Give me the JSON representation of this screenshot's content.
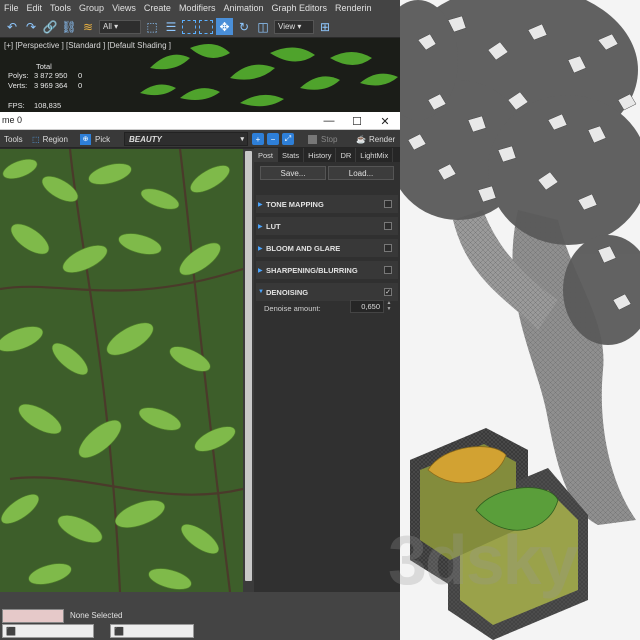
{
  "menubar": {
    "items": [
      "File",
      "Edit",
      "Tools",
      "Group",
      "Views",
      "Create",
      "Modifiers",
      "Animation",
      "Graph Editors",
      "Renderin"
    ]
  },
  "toolbar": {
    "selection_filter": "All",
    "view_dropdown": "View",
    "icons": [
      "undo-icon",
      "redo-icon",
      "link-icon",
      "unlink-icon",
      "bind-spacewarp-icon",
      "select-icon",
      "select-by-name-icon",
      "rect-region-icon",
      "window-crossing-icon",
      "move-icon",
      "rotate-icon",
      "scale-icon"
    ]
  },
  "viewport": {
    "label": "[+] [Perspective ] [Standard ] [Default Shading ]",
    "total_label": "Total",
    "polys_label": "Polys:",
    "polys_total": "3 872 950",
    "polys_sel": "0",
    "verts_label": "Verts:",
    "verts_total": "3 969 364",
    "verts_sel": "0",
    "fps_label": "FPS:",
    "fps_value": "108,835"
  },
  "frame_buffer": {
    "title": "me 0",
    "minimize": "—",
    "maximize": "☐",
    "close": "✕",
    "tools_label": "Tools",
    "region_label": "Region",
    "pick_label": "Pick",
    "channel": "BEAUTY",
    "stop_label": "Stop",
    "render_label": "Render"
  },
  "post_panel": {
    "tabs": [
      "Post",
      "Stats",
      "History",
      "DR",
      "LightMix"
    ],
    "save_label": "Save...",
    "load_label": "Load...",
    "sections": [
      {
        "label": "TONE MAPPING",
        "arrow": "▶",
        "checked": ""
      },
      {
        "label": "LUT",
        "arrow": "▶",
        "checked": ""
      },
      {
        "label": "BLOOM AND GLARE",
        "arrow": "▶",
        "checked": ""
      },
      {
        "label": "SHARPENING/BLURRING",
        "arrow": "▶",
        "checked": ""
      },
      {
        "label": "DENOISING",
        "arrow": "▼",
        "checked": "✓"
      }
    ],
    "denoise_label": "Denoise amount:",
    "denoise_value": "0,650"
  },
  "statusbar": {
    "selection": "None Selected"
  },
  "watermark": "3dsky",
  "colors": {
    "accent": "#2e7fd8",
    "panel": "#303030",
    "section": "#383838"
  }
}
